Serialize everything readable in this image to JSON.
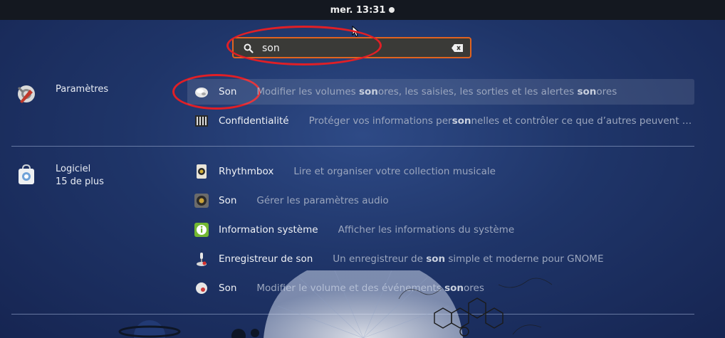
{
  "topbar": {
    "clock": "mer. 13:31"
  },
  "search": {
    "value": "son",
    "placeholder": ""
  },
  "providers": [
    {
      "label": "Paramètres",
      "sublabel": "",
      "results": [
        {
          "name": "Son",
          "desc_parts": [
            "Modifier les volumes ",
            "son",
            "ores, les saisies, les sorties et les alertes ",
            "son",
            "ores"
          ],
          "icon": "speaker-settings-icon"
        },
        {
          "name": "Confidentialité",
          "desc_parts": [
            "Protéger vos informations per",
            "son",
            "nelles et contrôler ce que d’autres peuvent …"
          ],
          "icon": "privacy-icon"
        }
      ]
    },
    {
      "label": "Logiciel",
      "sublabel": "15 de plus",
      "results": [
        {
          "name": "Rhythmbox",
          "desc_parts": [
            "Lire et organiser votre collection musicale"
          ],
          "icon": "rhythmbox-icon"
        },
        {
          "name": "Son",
          "desc_parts": [
            "Gérer les paramètres audio"
          ],
          "icon": "speaker-icon"
        },
        {
          "name": "Information système",
          "desc_parts": [
            "Afficher les informations du système"
          ],
          "icon": "info-icon"
        },
        {
          "name": "Enregistreur de son",
          "desc_parts": [
            "Un enregistreur de ",
            "son",
            " simple et moderne pour GNOME"
          ],
          "icon": "microphone-icon"
        },
        {
          "name": "Son",
          "desc_parts": [
            "Modifier le volume et des événements ",
            "son",
            "ores"
          ],
          "icon": "sound-events-icon"
        }
      ]
    }
  ]
}
